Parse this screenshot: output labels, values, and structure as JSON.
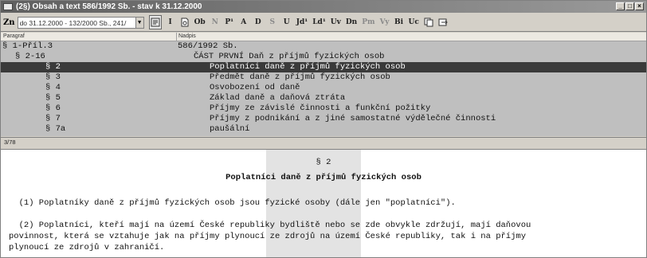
{
  "window": {
    "title": "(2§) Obsah a text 586/1992 Sb. - stav k 31.12.2000",
    "controls": [
      "_",
      "□",
      "×"
    ]
  },
  "toolbar": {
    "zn_label": "Zn",
    "combo_value": "do 31.12.2000 - 132/2000 Sb., 241/",
    "buttons": [
      "I",
      "Ob",
      "N",
      "P¹",
      "A",
      "D",
      "S",
      "U",
      "Jd¹",
      "Ld¹",
      "Uv",
      "Dn",
      "Pm",
      "Vy",
      "Bi",
      "Uc"
    ]
  },
  "columns": {
    "paragraf": "Paragraf",
    "nadpis": "Nadpis"
  },
  "tree": {
    "rows": [
      {
        "p": "§ 1-Příl.3",
        "n": "586/1992 Sb."
      },
      {
        "p": "§ 2-16",
        "n": "ČÁST PRVNÍ Daň z příjmů fyzických osob"
      },
      {
        "p": "§ 2",
        "n": "Poplatníci daně z příjmů fyzických osob",
        "selected": true
      },
      {
        "p": "§ 3",
        "n": "Předmět daně z příjmů fyzických osob"
      },
      {
        "p": "§ 4",
        "n": "Osvobození od daně"
      },
      {
        "p": "§ 5",
        "n": "Základ daně a daňová ztráta"
      },
      {
        "p": "§ 6",
        "n": "Příjmy ze závislé činnosti a funkční požitky"
      },
      {
        "p": "§ 7",
        "n": "Příjmy z podnikání a z jiné samostatné výdělečné činnosti"
      },
      {
        "p": "§ 7a",
        "n": "paušální"
      }
    ]
  },
  "status": {
    "position": "3/78"
  },
  "document": {
    "paragraph_no": "§ 2",
    "heading": "Poplatníci daně z příjmů fyzických osob",
    "lines": [
      "  (1) Poplatníky daně z příjmů fyzických osob jsou fyzické osoby (dále jen \"poplatníci\").",
      "",
      "  (2) Poplatníci, kteří mají na území České republiky bydliště nebo se zde obvykle zdržují, mají daňovou",
      "povinnost, která se vztahuje jak na příjmy plynoucí ze zdrojů na území České republiky, tak i na příjmy",
      "plynoucí ze zdrojů v zahraničí."
    ]
  }
}
